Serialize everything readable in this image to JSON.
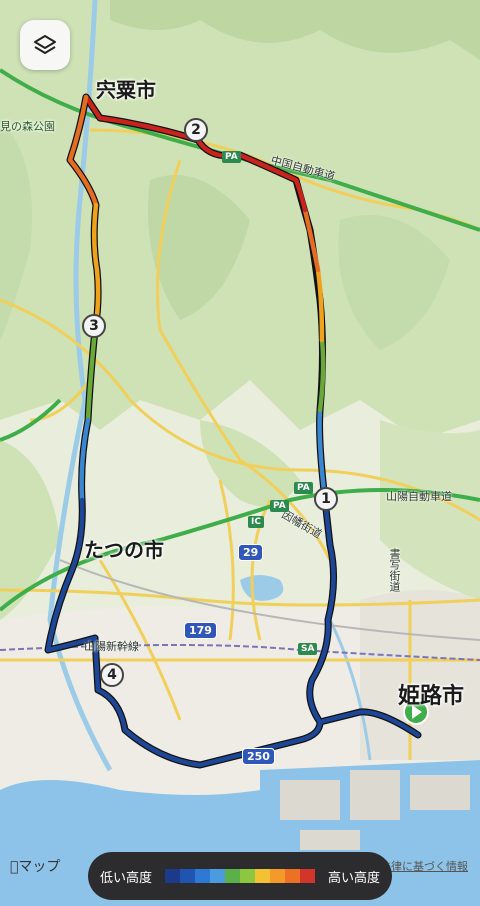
{
  "map": {
    "cities": {
      "shiso": "宍粟市",
      "tatsuno": "たつの市",
      "himeji": "姫路市"
    },
    "park_label": "見の森公園",
    "highways": {
      "chugoku": "中国自動車道",
      "sanyo": "山陽自動車道",
      "harima": "因幡街道",
      "shinkansen": "山陽新幹線",
      "shoshazan": "書写街道"
    },
    "route_shields": [
      "179",
      "29",
      "250"
    ],
    "ic_labels": [
      "PA",
      "PA",
      "IC",
      "PA",
      "SA"
    ],
    "markers": [
      "1",
      "2",
      "3",
      "4"
    ],
    "route_colors": {
      "low": "#1c3f8f",
      "mid_low": "#3b8fd8",
      "mid": "#6aa83a",
      "mid_high": "#f0a21c",
      "high": "#c8241c"
    }
  },
  "controls": {
    "layer_button": "layers-icon"
  },
  "legend": {
    "low_label": "低い高度",
    "high_label": "高い高度",
    "colors": [
      "#1b3a8a",
      "#1f55b0",
      "#2f79d4",
      "#4a9be0",
      "#5bb04a",
      "#8dc63f",
      "#f2c232",
      "#f39a28",
      "#ec7124",
      "#d4352a"
    ]
  },
  "footer": {
    "apple_maps": "マップ",
    "legal": "法律に基づく情報"
  }
}
